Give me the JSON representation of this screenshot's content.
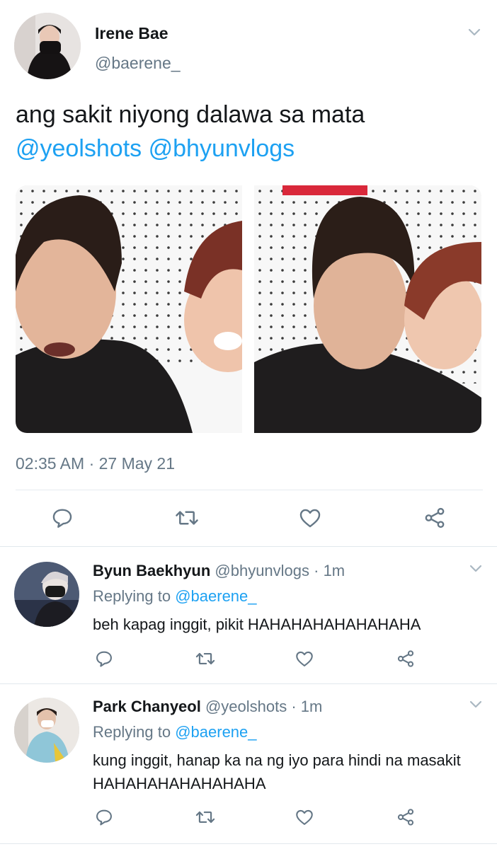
{
  "tweet": {
    "author_name": "Irene Bae",
    "author_handle": "@baerene_",
    "text_plain": "ang sakit niyong dalawa sa mata",
    "mention_1": "@yeolshots",
    "mention_2": "@bhyunvlogs",
    "timestamp": "02:35 AM · 27 May 21"
  },
  "actions": {
    "icons": [
      "reply-icon",
      "retweet-icon",
      "like-icon",
      "share-icon"
    ]
  },
  "replies": [
    {
      "author_name": "Byun Baekhyun",
      "handle_time": "@bhyunvlogs · 1m",
      "replying_prefix": "Replying to",
      "replying_to": "@baerene_",
      "text": "beh kapag inggit, pikit HAHAHAHAHAHAHAHA"
    },
    {
      "author_name": "Park Chanyeol",
      "handle_time": "@yeolshots · 1m",
      "replying_prefix": "Replying to",
      "replying_to": "@baerene_",
      "text": "kung inggit, hanap ka na ng iyo para hindi na masakit HAHAHAHAHAHAHAHA"
    }
  ],
  "colors": {
    "link_blue": "#1da1f2",
    "secondary_gray": "#657786",
    "icon_gray": "#657786",
    "divider": "#e6ecf0"
  }
}
